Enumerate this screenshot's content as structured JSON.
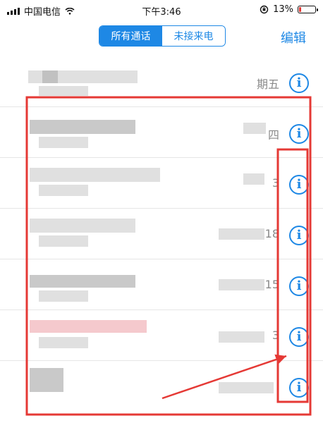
{
  "status": {
    "carrier": "中国电信",
    "time": "下午3:46",
    "battery_percent": "13%",
    "battery_level": 0.13,
    "wifi_icon": "wifi-icon",
    "lock_icon": "orientation-lock-icon",
    "battery_fill_color": "#e53935"
  },
  "nav": {
    "tabs": [
      {
        "label": "所有通话",
        "selected": true
      },
      {
        "label": "未接来电",
        "selected": false
      }
    ],
    "edit_label": "编辑",
    "accent_color": "#1e88e5"
  },
  "calls": [
    {
      "date_fragment": "期五",
      "info_icon": "info-icon"
    },
    {
      "date_fragment": "四",
      "info_icon": "info-icon"
    },
    {
      "date_fragment": "3",
      "info_icon": "info-icon"
    },
    {
      "date_fragment": "18",
      "info_icon": "info-icon"
    },
    {
      "date_fragment": "15",
      "info_icon": "info-icon"
    },
    {
      "date_fragment": "3",
      "info_icon": "info-icon"
    },
    {
      "date_fragment": "",
      "info_icon": "info-icon"
    }
  ],
  "annotation": {
    "highlight_color": "#e53935"
  }
}
